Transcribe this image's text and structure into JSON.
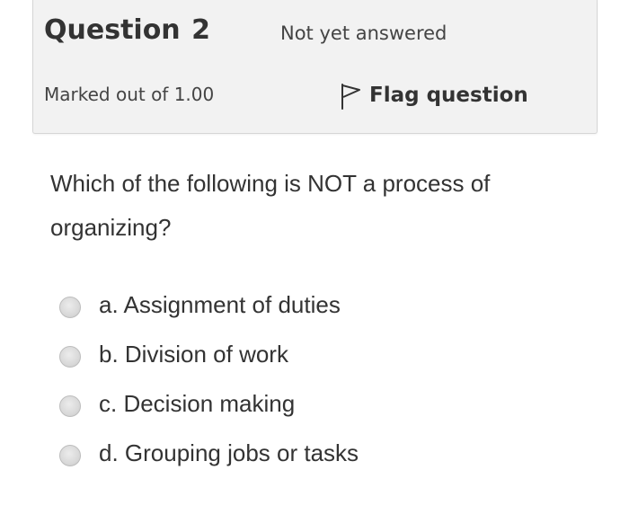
{
  "question_info": {
    "title": "Question",
    "number": "2",
    "state": "Not yet answered",
    "grade": "Marked out of 1.00",
    "flag_label": "Flag question"
  },
  "question": {
    "text": "Which of the following is NOT a process of organizing?"
  },
  "answers": [
    {
      "label": "a. Assignment of duties"
    },
    {
      "label": "b. Division of work"
    },
    {
      "label": "c. Decision making"
    },
    {
      "label": "d. Grouping jobs or tasks"
    }
  ],
  "icons": {
    "flag": "flag-icon",
    "radio": "radio-unchecked"
  },
  "colors": {
    "info_background": "#f2f2f2",
    "text": "#333333",
    "radio": "#d9d9d9"
  }
}
